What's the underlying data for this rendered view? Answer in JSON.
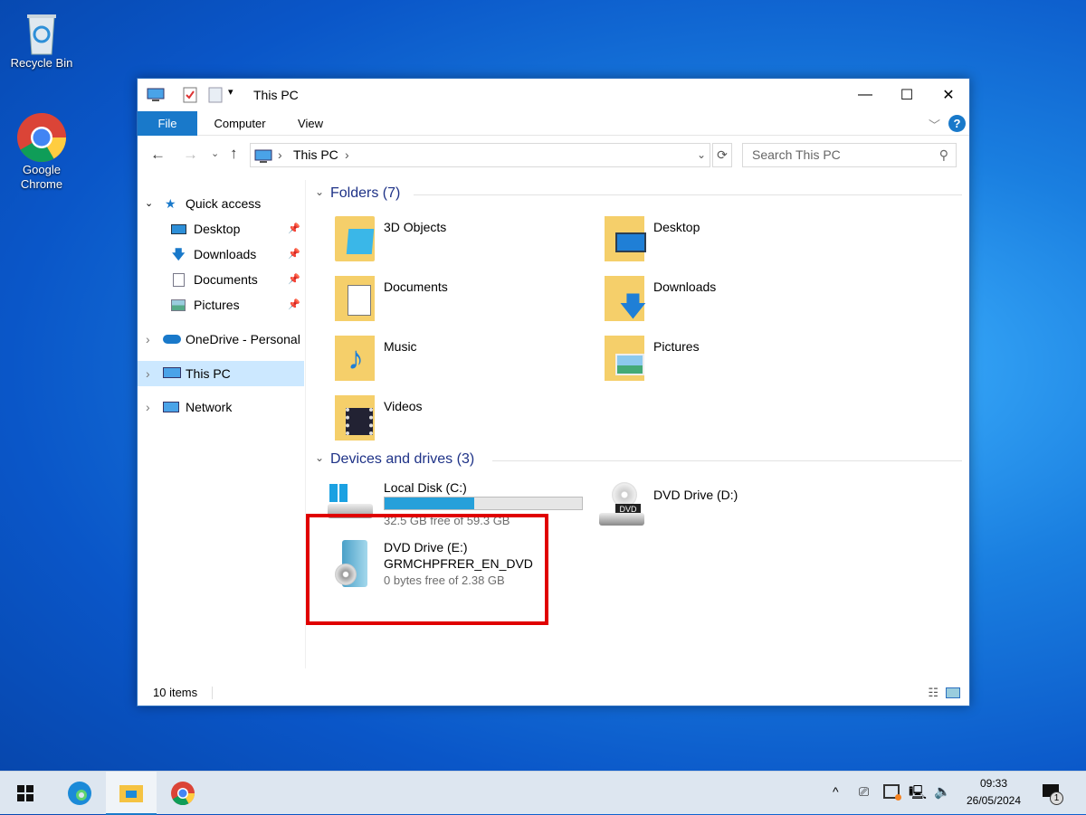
{
  "desktop": {
    "icons": [
      {
        "label": "Recycle Bin"
      },
      {
        "label": "Google Chrome"
      }
    ]
  },
  "window": {
    "title": "This PC",
    "tabs": [
      "File",
      "Computer",
      "View"
    ],
    "address": {
      "path": "This PC",
      "search_placeholder": "Search This PC"
    },
    "nav": {
      "quick_access": "Quick access",
      "items": [
        "Desktop",
        "Downloads",
        "Documents",
        "Pictures"
      ],
      "onedrive": "OneDrive - Personal",
      "this_pc": "This PC",
      "network": "Network"
    },
    "folders": {
      "header": "Folders (7)",
      "items": [
        "3D Objects",
        "Desktop",
        "Documents",
        "Downloads",
        "Music",
        "Pictures",
        "Videos"
      ]
    },
    "drives": {
      "header": "Devices and drives (3)",
      "items": [
        {
          "name": "Local Disk (C:)",
          "free": "32.5 GB free of 59.3 GB",
          "used_fraction": 0.452
        },
        {
          "name": "DVD Drive (D:)"
        },
        {
          "name": "DVD Drive (E:)",
          "label": "GRMCHPFRER_EN_DVD",
          "free": "0 bytes free of 2.38 GB"
        }
      ]
    },
    "status": "10 items"
  },
  "taskbar": {
    "time": "09:33",
    "date": "26/05/2024",
    "notifications": "1"
  },
  "colors": {
    "accent": "#1979ca",
    "highlight": "#cce8ff",
    "annotation": "#e00000"
  }
}
